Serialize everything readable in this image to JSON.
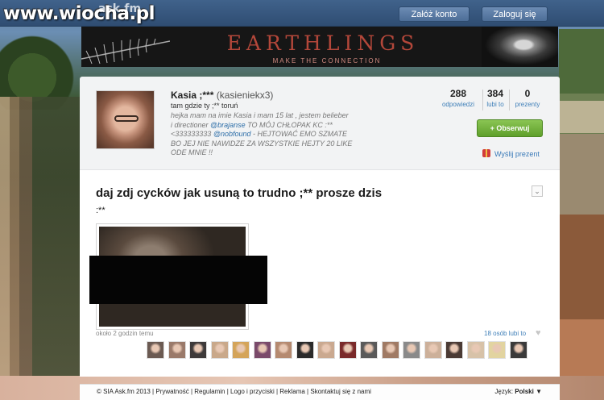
{
  "watermark": {
    "site": "www.wiocha.pl",
    "overlay": "ask.fm"
  },
  "topbar": {
    "register_label": "Załóż konto",
    "login_label": "Zaloguj się"
  },
  "banner": {
    "title": "EARTHLINGS",
    "subtitle": "MAKE THE CONNECTION"
  },
  "profile": {
    "name": "Kasia ;***",
    "username": "(kasieniekx3)",
    "location": "tam gdzie ty ;** toruń",
    "bio_lines": [
      {
        "text": "hejka mam na imie Kasia i mam 15 lat , jestem belieber"
      },
      {
        "pre": "i directioner ",
        "mention": "@brajanse",
        "post": " TO MÓJ CHŁOPAK KC :**"
      },
      {
        "pre": "<333333333 ",
        "mention": "@nobfound",
        "post": " - HEJTOWAĆ EMO SZMATE"
      },
      {
        "text": "BO JEJ NIE NAWIDZE ZA WSZYSTKIE HEJTY 20 LIKE"
      },
      {
        "text": "ODE MNIE !!"
      }
    ],
    "stats": [
      {
        "value": "288",
        "label": "odpowiedzi"
      },
      {
        "value": "384",
        "label": "lubi to"
      },
      {
        "value": "0",
        "label": "prezenty"
      }
    ],
    "follow_label": "+ Obserwuj",
    "gift_label": "Wyślij prezent"
  },
  "question": {
    "title": "daj zdj cycków jak usuną to trudno ;** prosze dzis",
    "answer": ":**",
    "time": "około 2 godzin temu",
    "likes_text": "18 osób lubi to",
    "likers_count_shown": 18,
    "liker_colors": [
      "#6b5a52",
      "#9a7a6a",
      "#3e3a3a",
      "#c9a88a",
      "#d4a45a",
      "#7a4a6a",
      "#b58a70",
      "#2a2a2a",
      "#caa990",
      "#7a2a2a",
      "#5a5a5a",
      "#a07a64",
      "#8a8a8a",
      "#ccb09a",
      "#4a3a34",
      "#d7c2a8",
      "#e2d4a0",
      "#3a3a3a"
    ]
  },
  "footer": {
    "links": [
      "© SIA Ask.fm 2013",
      "Prywatność",
      "Regulamin",
      "Logo i przyciski",
      "Reklama",
      "Skontaktuj się z nami"
    ],
    "language_label": "Język:",
    "language_value": "Polski ▼"
  }
}
